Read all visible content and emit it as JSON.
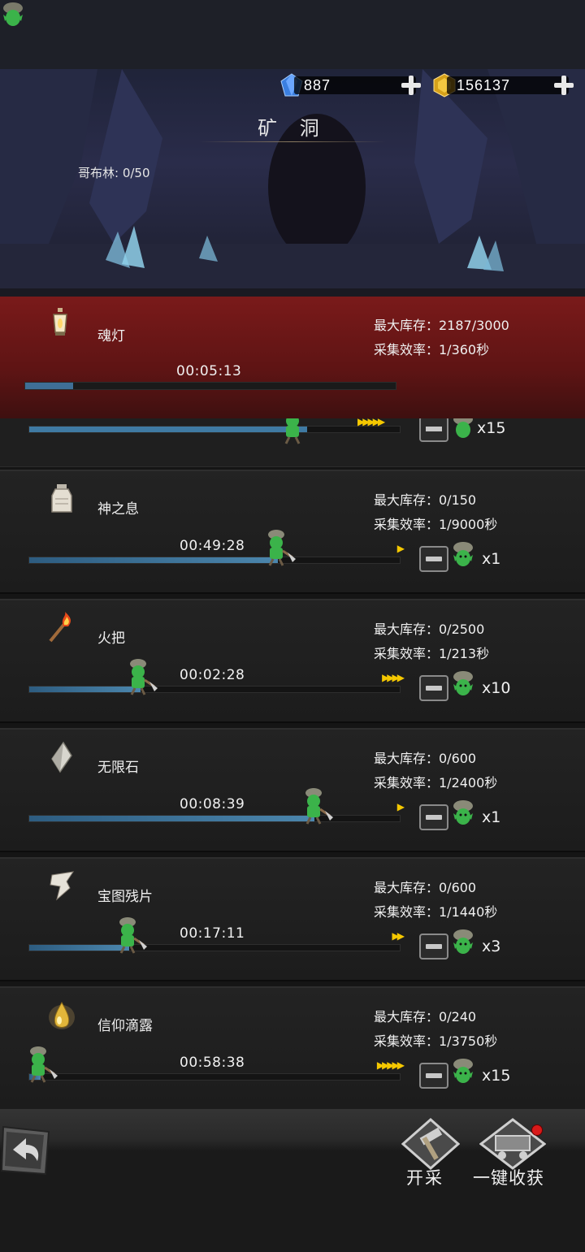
{
  "currency": {
    "diamond": "887",
    "gold": "156137"
  },
  "page": {
    "title": "矿 洞",
    "goblin_count": "哥布林: 0/50"
  },
  "active_item": {
    "name": "魂灯",
    "stock": "最大库存：2187/3000",
    "rate": "采集效率：1/360秒",
    "time": "00:05:13",
    "progress": 0.13,
    "icon": "lantern-icon"
  },
  "items": [
    {
      "name": "神之息",
      "icon": "bottle-icon",
      "stock": "最大库存：0/150",
      "rate": "采集效率：1/9000秒",
      "time": "00:49:28",
      "progress": 0.67,
      "arrows": 1,
      "count": "x1"
    },
    {
      "name": "火把",
      "icon": "torch-icon",
      "stock": "最大库存：0/2500",
      "rate": "采集效率：1/213秒",
      "time": "00:02:28",
      "progress": 0.3,
      "arrows": 4,
      "count": "x10"
    },
    {
      "name": "无限石",
      "icon": "crystal-icon",
      "stock": "最大库存：0/600",
      "rate": "采集效率：1/2400秒",
      "time": "00:08:39",
      "progress": 0.77,
      "arrows": 1,
      "count": "x1"
    },
    {
      "name": "宝图残片",
      "icon": "map-fragment-icon",
      "stock": "最大库存：0/600",
      "rate": "采集效率：1/1440秒",
      "time": "00:17:11",
      "progress": 0.27,
      "arrows": 2,
      "count": "x3"
    },
    {
      "name": "信仰滴露",
      "icon": "dew-drop-icon",
      "stock": "最大库存：0/240",
      "rate": "采集效率：1/3750秒",
      "time": "00:58:38",
      "progress": 0.03,
      "arrows": 5,
      "count": "x15"
    }
  ],
  "peek_row": {
    "count": "x15",
    "arrows": 5
  },
  "bottom": {
    "start_label": "开采",
    "collect_label": "一键收获"
  },
  "colors": {
    "highlight": "#6a1616",
    "progress": "#3f7aa3",
    "arrow": "#f5c800"
  }
}
